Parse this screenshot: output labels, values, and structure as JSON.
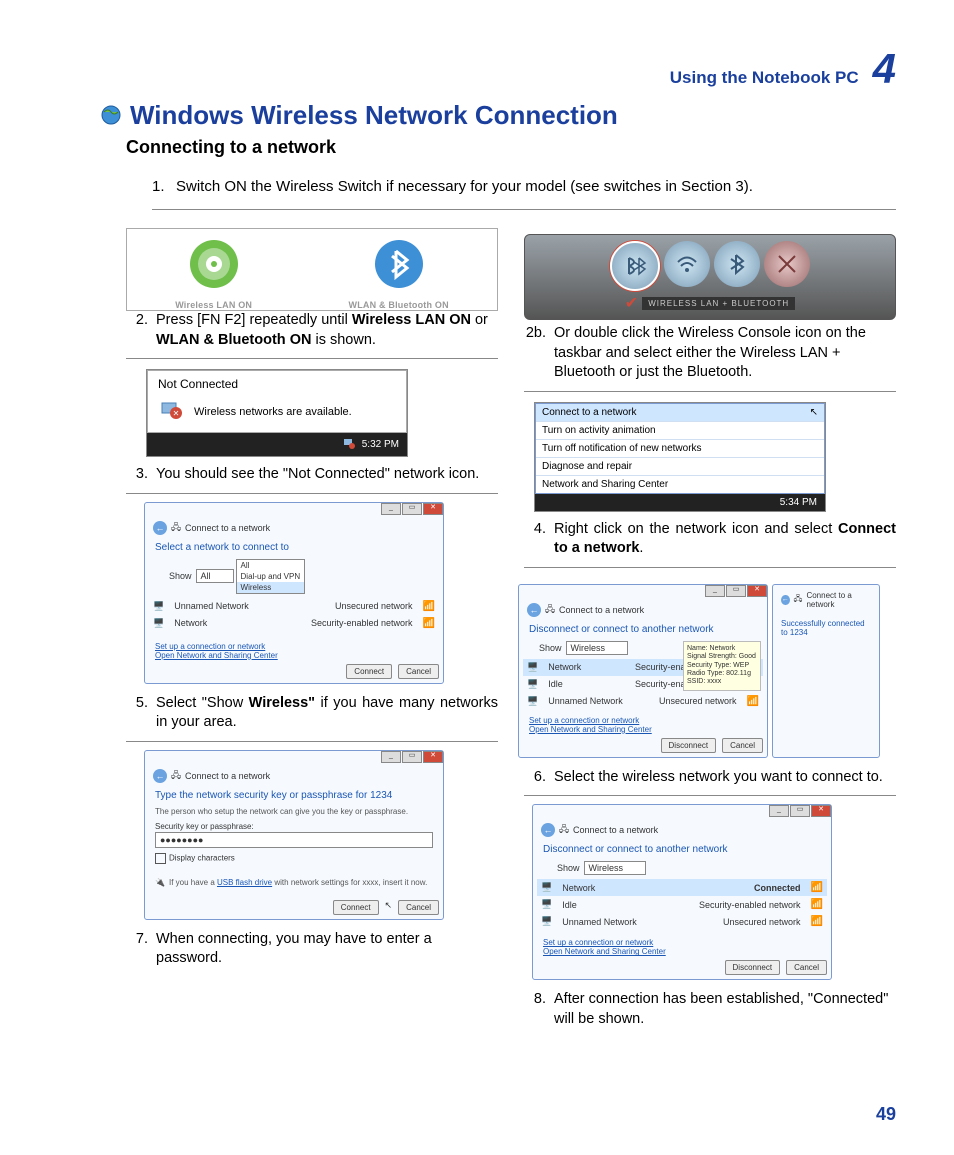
{
  "header": {
    "chapter_title": "Using the Notebook PC",
    "chapter_num": "4"
  },
  "title": "Windows Wireless Network Connection",
  "subtitle": "Connecting to a network",
  "step1": {
    "n": "1.",
    "text": "Switch ON the Wireless Switch if necessary for your model (see switches in Section 3)."
  },
  "fig_icons": {
    "left_caption": "Wireless LAN ON",
    "right_caption": "WLAN & Bluetooth ON"
  },
  "step2": {
    "n": "2.",
    "pre": "Press [FN F2] repeatedly until ",
    "b1": "Wireless LAN ON",
    "mid": " or ",
    "b2": "WLAN & Bluetooth ON",
    "post": " is shown."
  },
  "console": {
    "label": "WIRELESS LAN + BLUETOOTH"
  },
  "step2b": {
    "n": "2b.",
    "text": "Or double click the Wireless Console icon on the taskbar and select either the Wireless LAN + Bluetooth or just the Bluetooth."
  },
  "tooltip3": {
    "title": "Not Connected",
    "text": "Wireless networks are available."
  },
  "time3": "5:32 PM",
  "step3": {
    "n": "3.",
    "text": "You should see the \"Not Connected\" network icon."
  },
  "menu4": {
    "items": [
      "Connect to a network",
      "Turn on activity animation",
      "Turn off notification of new networks",
      "Diagnose and repair",
      "Network and Sharing Center"
    ]
  },
  "time4": "5:34 PM",
  "step4": {
    "n": "4.",
    "pre": "Right click on the network icon and select ",
    "b": "Connect to a network",
    "post": "."
  },
  "win5": {
    "header": "Connect to a network",
    "title": "Select a network to connect to",
    "show_label": "Show",
    "show_value": "All",
    "dd_opts": [
      "All",
      "Dial-up and VPN",
      "Wireless"
    ],
    "rows": [
      {
        "name": "Unnamed Network",
        "sec": "Unsecured network"
      },
      {
        "name": "Network",
        "sec": "Security-enabled network"
      }
    ],
    "links": [
      "Set up a connection or network",
      "Open Network and Sharing Center"
    ],
    "btn1": "Connect",
    "btn2": "Cancel"
  },
  "step5": {
    "n": "5.",
    "pre": "Select \"Show ",
    "b": "Wireless\"",
    "post": " if you have many networks in your area."
  },
  "win6": {
    "header": "Connect to a network",
    "title": "Disconnect or connect to another network",
    "show_label": "Show",
    "show_value": "Wireless",
    "rows": [
      {
        "name": "Network",
        "sec": "Security-enabled network"
      },
      {
        "name": "Idle",
        "sec": "Security-enabled network"
      },
      {
        "name": "Unnamed Network",
        "sec": "Unsecured network"
      }
    ],
    "tip": "Name: Network\nSignal Strength: Good\nSecurity Type: WEP\nRadio Type: 802.11g\nSSID: xxxx",
    "links": [
      "Set up a connection or network",
      "Open Network and Sharing Center"
    ],
    "btn1": "Disconnect",
    "btn2": "Cancel",
    "side_header": "Connect to a network",
    "side_msg": "Successfully connected to 1234"
  },
  "step6": {
    "n": "6.",
    "text": "Select the wireless network you want to connect to."
  },
  "win7": {
    "header": "Connect to a network",
    "title": "Type the network security key or passphrase for 1234",
    "sub": "The person who setup the network can give you the key or passphrase.",
    "field_label": "Security key or passphrase:",
    "field_value": "●●●●●●●●",
    "chk": "Display characters",
    "tip_pre": "If you have a ",
    "tip_link": "USB flash drive",
    "tip_post": " with network settings for xxxx, insert it now.",
    "btn1": "Connect",
    "btn2": "Cancel"
  },
  "step7": {
    "n": "7.",
    "text": "When connecting, you may have to enter a password."
  },
  "win8": {
    "header": "Connect to a network",
    "title": "Disconnect or connect to another network",
    "show_label": "Show",
    "show_value": "Wireless",
    "rows": [
      {
        "name": "Network",
        "sec": "Connected"
      },
      {
        "name": "Idle",
        "sec": "Security-enabled network"
      },
      {
        "name": "Unnamed Network",
        "sec": "Unsecured network"
      }
    ],
    "links": [
      "Set up a connection or network",
      "Open Network and Sharing Center"
    ],
    "btn1": "Disconnect",
    "btn2": "Cancel"
  },
  "step8": {
    "n": "8.",
    "text": "After connection has been established, \"Connected\" will be shown."
  },
  "page_num": "49"
}
